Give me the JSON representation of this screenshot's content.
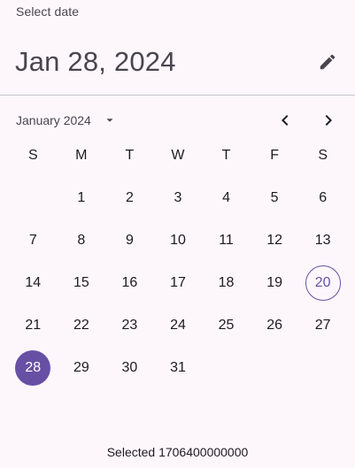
{
  "header": {
    "label": "Select date",
    "headline": "Jan 28, 2024",
    "edit_icon": "pencil-icon"
  },
  "month_bar": {
    "month_label": "January 2024",
    "dropdown_icon": "arrow-drop-down-icon",
    "prev_icon": "chevron-left-icon",
    "next_icon": "chevron-right-icon"
  },
  "calendar": {
    "weekdays": [
      "S",
      "M",
      "T",
      "W",
      "T",
      "F",
      "S"
    ],
    "weeks": [
      [
        "",
        "1",
        "2",
        "3",
        "4",
        "5",
        "6"
      ],
      [
        "7",
        "8",
        "9",
        "10",
        "11",
        "12",
        "13"
      ],
      [
        "14",
        "15",
        "16",
        "17",
        "18",
        "19",
        "20"
      ],
      [
        "21",
        "22",
        "23",
        "24",
        "25",
        "26",
        "27"
      ],
      [
        "28",
        "29",
        "30",
        "31",
        "",
        "",
        ""
      ]
    ],
    "today": "20",
    "selected": "28"
  },
  "footer": {
    "text": "Selected 1706400000000"
  },
  "colors": {
    "primary": "#6750a4",
    "background": "#fdf7fc",
    "on_surface": "#1d1b20",
    "on_surface_variant": "#49454f",
    "divider": "#c8c4cb"
  }
}
